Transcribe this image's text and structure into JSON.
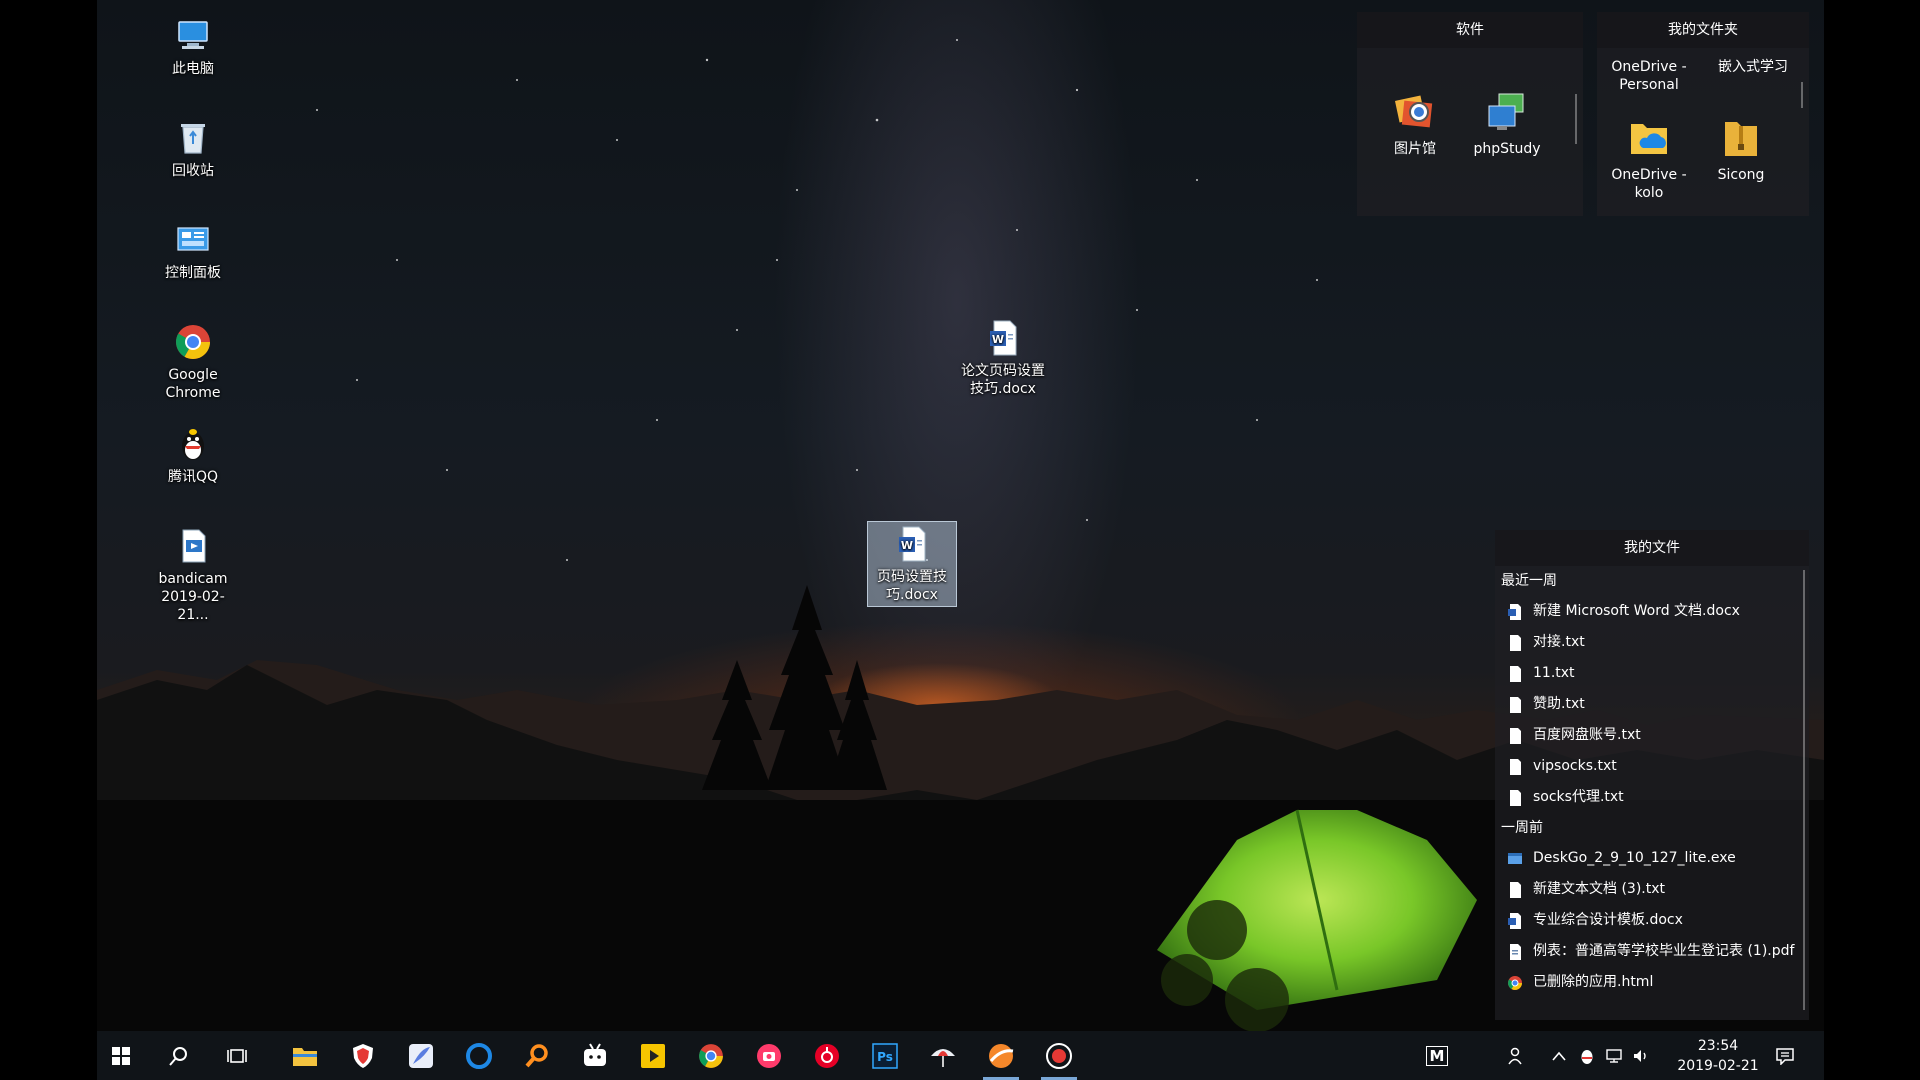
{
  "desktop_icons": [
    {
      "label": "此电脑",
      "icon": "computer-icon"
    },
    {
      "label": "回收站",
      "icon": "recycle-bin-icon"
    },
    {
      "label": "控制面板",
      "icon": "control-panel-icon"
    },
    {
      "label": "Google Chrome",
      "icon": "chrome-icon"
    },
    {
      "label": "腾讯QQ",
      "icon": "qq-icon"
    },
    {
      "label": "bandicam 2019-02-21...",
      "icon": "video-file-icon"
    }
  ],
  "desktop_files": [
    {
      "label": "论文页码设置技巧.docx",
      "icon": "word-doc-icon"
    },
    {
      "label": "页码设置技巧.docx",
      "icon": "word-doc-icon",
      "selected": true
    }
  ],
  "fence_software": {
    "title": "软件",
    "items": [
      {
        "label": "图片馆",
        "icon": "photo-gallery-icon"
      },
      {
        "label": "phpStudy",
        "icon": "phpstudy-icon"
      }
    ]
  },
  "fence_folders": {
    "title": "我的文件夹",
    "items": [
      {
        "label": "OneDrive - Personal",
        "icon": "onedrive-folder-icon"
      },
      {
        "label": "嵌入式学习",
        "icon": "folder-icon"
      },
      {
        "label": "OneDrive - kolo",
        "icon": "onedrive-folder-icon"
      },
      {
        "label": "Sicong",
        "icon": "zip-folder-icon"
      }
    ]
  },
  "fence_files": {
    "title": "我的文件",
    "section_recent": "最近一周",
    "recent": [
      {
        "label": "新建 Microsoft Word 文档.docx",
        "icon": "word-doc-icon"
      },
      {
        "label": "对接.txt",
        "icon": "text-file-icon"
      },
      {
        "label": "11.txt",
        "icon": "text-file-icon"
      },
      {
        "label": "赞助.txt",
        "icon": "text-file-icon"
      },
      {
        "label": "百度网盘账号.txt",
        "icon": "text-file-icon"
      },
      {
        "label": "vipsocks.txt",
        "icon": "text-file-icon"
      },
      {
        "label": "socks代理.txt",
        "icon": "text-file-icon"
      }
    ],
    "section_older": "一周前",
    "older": [
      {
        "label": "DeskGo_2_9_10_127_lite.exe",
        "icon": "exe-file-icon"
      },
      {
        "label": "新建文本文档 (3).txt",
        "icon": "text-file-icon"
      },
      {
        "label": "专业综合设计模板.docx",
        "icon": "word-doc-icon"
      },
      {
        "label": "例表：普通高等学校毕业生登记表 (1).pdf",
        "icon": "pdf-file-icon"
      },
      {
        "label": "已删除的应用.html",
        "icon": "chrome-html-icon"
      }
    ]
  },
  "taskbar": {
    "apps": [
      "windows-start-icon",
      "search-icon",
      "task-view-icon",
      "file-explorer-icon",
      "security-shield-icon",
      "feather-mail-icon",
      "cortana-icon",
      "search-tool-icon",
      "bilibili-icon",
      "media-player-icon",
      "chrome-icon",
      "camera-app-icon",
      "netease-music-icon",
      "photoshop-icon",
      "umbrella-app-icon",
      "browser-orb-icon",
      "record-icon"
    ],
    "tray_m_label": "M",
    "clock_time": "23:54",
    "clock_date": "2019-02-21"
  },
  "colors": {
    "accent": "#7aa7d6",
    "fence_bg": "#1e1e22",
    "tent_green": "#7fd12a",
    "sunset": "#e2691f"
  }
}
